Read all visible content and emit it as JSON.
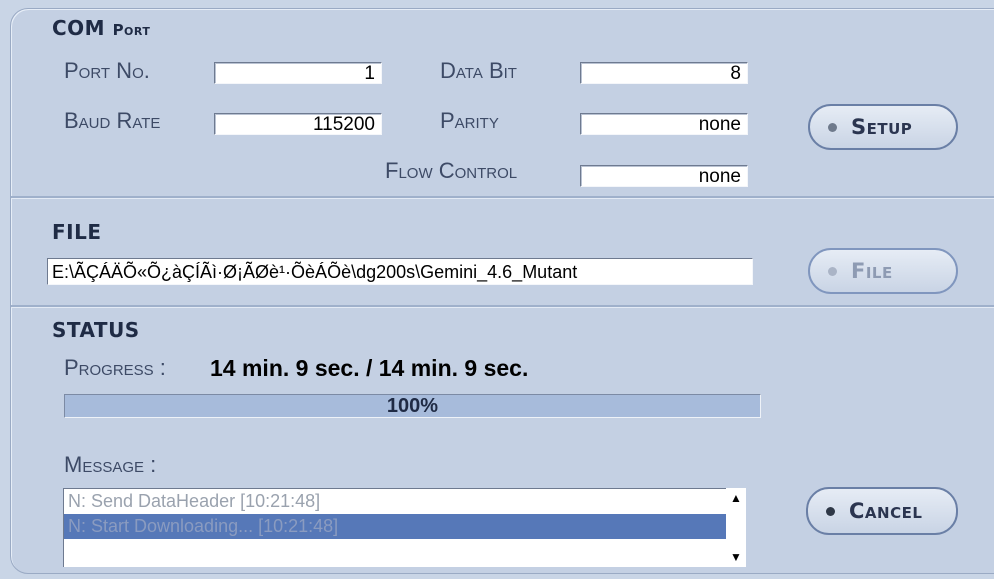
{
  "com_port": {
    "title_main": "COM",
    "title_sc": "Port",
    "port_no_label": "Port No.",
    "port_no_value": "1",
    "baud_rate_label": "Baud Rate",
    "baud_rate_value": "115200",
    "data_bit_label": "Data Bit",
    "data_bit_value": "8",
    "parity_label": "Parity",
    "parity_value": "none",
    "flow_control_label": "Flow Control",
    "flow_control_value": "none",
    "setup_button": "Setup"
  },
  "file": {
    "title": "FILE",
    "path": "E:\\ÃÇÁÄÕ«Õ¿àÇÍÃì·Ø¡ÃØè¹·ÕèÁÕè\\dg200s\\Gemini_4.6_Mutant",
    "file_button": "File"
  },
  "status": {
    "title": "STATUS",
    "progress_label": "Progress :",
    "progress_value": "14 min.  9 sec. / 14 min. 9 sec.",
    "progress_percent_text": "100%",
    "progress_fraction": 1.0,
    "message_label": "Message :",
    "messages": [
      {
        "text": "N: Send DataHeader [10:21:48]"
      },
      {
        "text": "N: Start Downloading... [10:21:48]"
      }
    ],
    "cancel_button": "Cancel"
  },
  "colors": {
    "panel_bg": "#c4d0e3",
    "selected_row": "#5678b8",
    "progress_fill": "#a7bbdb"
  }
}
